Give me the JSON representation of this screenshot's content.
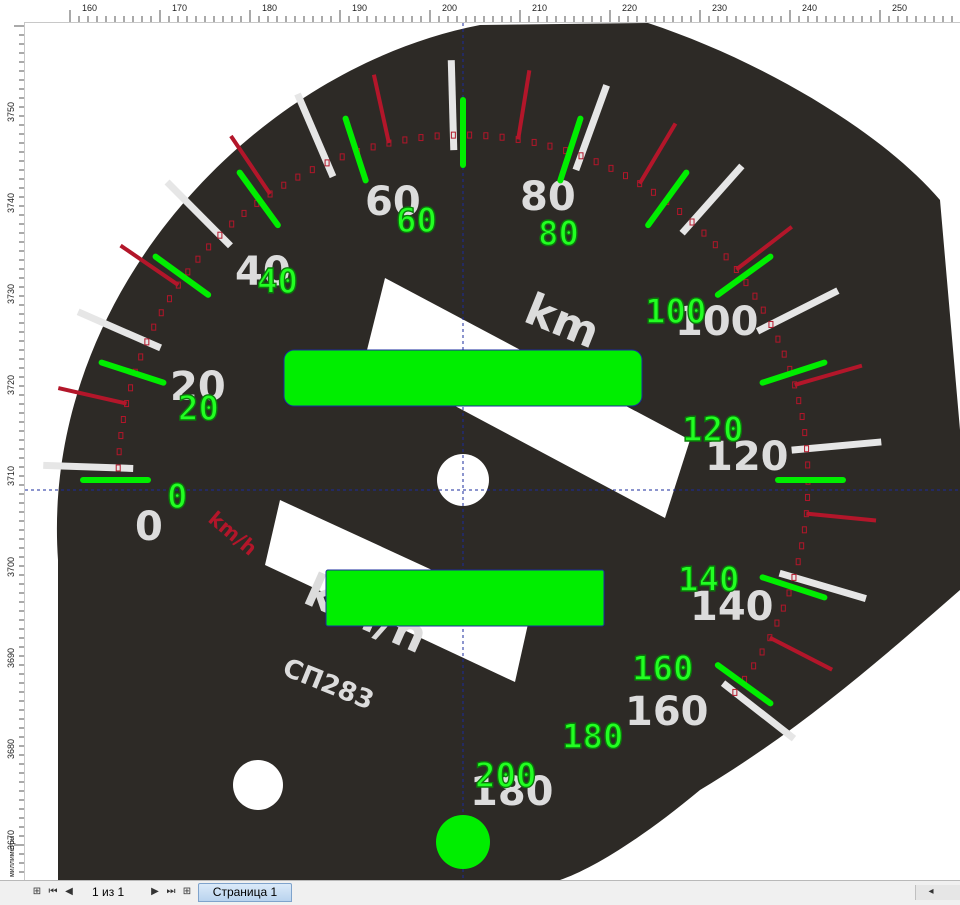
{
  "ruler": {
    "unit_label": "миллиметры",
    "top_labels": [
      "160",
      "170",
      "180",
      "190",
      "200",
      "210",
      "220",
      "230",
      "240",
      "250"
    ],
    "left_labels": [
      "3750",
      "3740",
      "3730",
      "3720",
      "3710",
      "3700",
      "3690",
      "3680",
      "3670"
    ]
  },
  "dial": {
    "scale_numbers": [
      "0",
      "20",
      "40",
      "60",
      "80",
      "100",
      "120",
      "140",
      "160",
      "180"
    ],
    "unit_big": "km/h",
    "unit_top": "km",
    "unit_small": "km/h",
    "model": "СП283"
  },
  "overlay_labels": [
    "0",
    "20",
    "40",
    "60",
    "80",
    "100",
    "120",
    "140",
    "160",
    "180",
    "200"
  ],
  "colors": {
    "dial_face": "#2d2a26",
    "overlay": "#00ee00",
    "red_mark": "#b3162a",
    "white_mark": "#e6e6e6",
    "guide": "#1a2b9c"
  },
  "statusbar": {
    "page_indicator": "1 из 1",
    "page_tab": "Страница 1"
  },
  "icons": {
    "first": "first-page-icon",
    "prev": "prev-page-icon",
    "next": "next-page-icon",
    "last": "last-page-icon",
    "add": "add-page-icon"
  }
}
